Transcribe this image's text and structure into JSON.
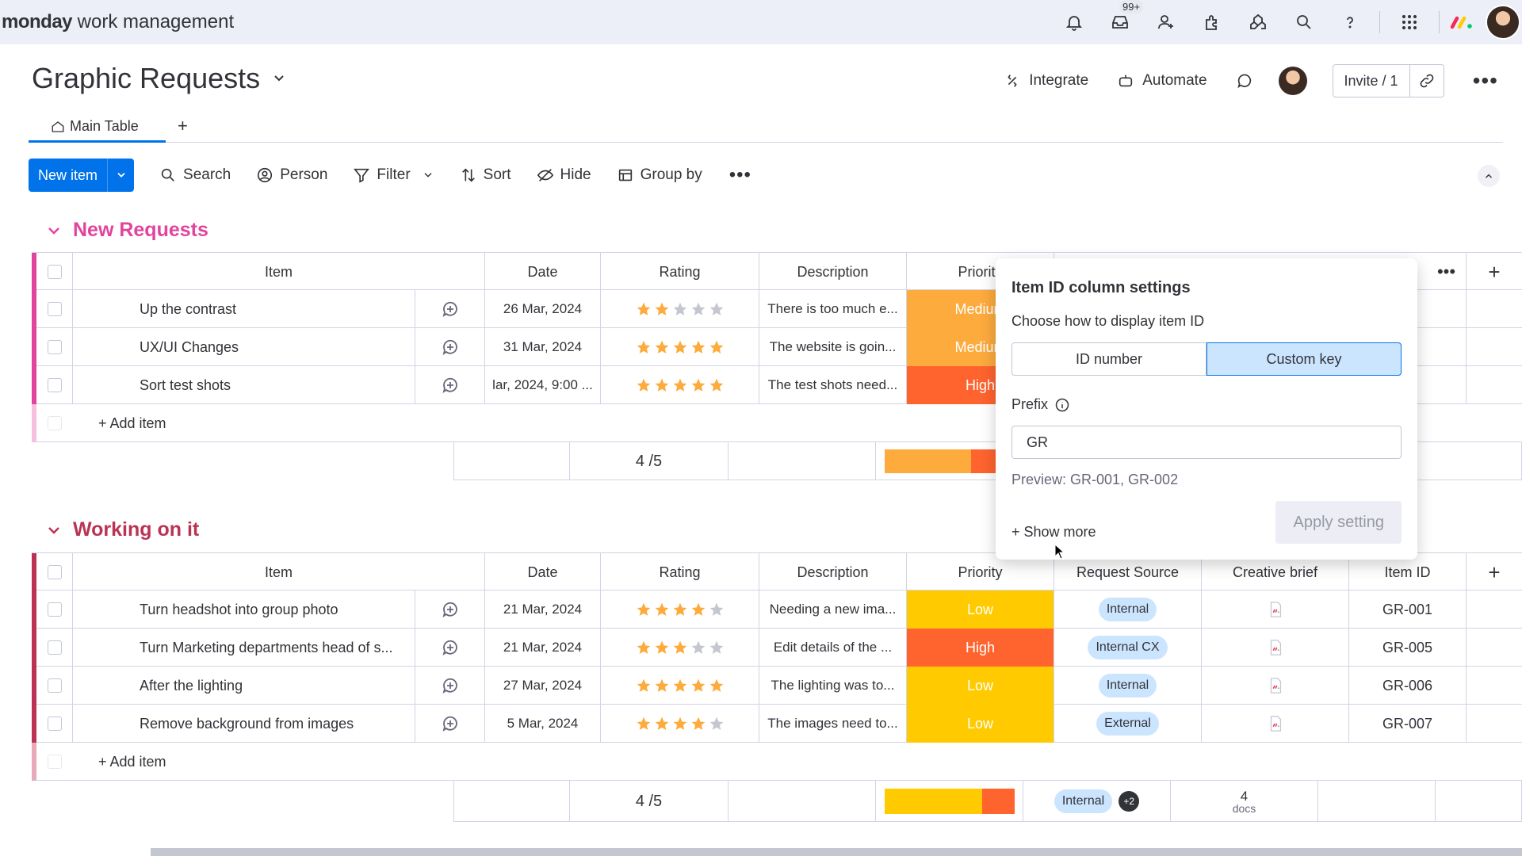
{
  "app": {
    "brand_bold": "monday",
    "brand_rest": " work management",
    "notif_badge": "99+"
  },
  "board": {
    "title": "Graphic Requests",
    "integrate": "Integrate",
    "automate": "Automate",
    "invite": "Invite / 1",
    "tab_main": "Main Table",
    "tab_add": "+"
  },
  "toolbar": {
    "new_item": "New item",
    "search": "Search",
    "person": "Person",
    "filter": "Filter",
    "sort": "Sort",
    "hide": "Hide",
    "group_by": "Group by"
  },
  "columns": {
    "item": "Item",
    "date": "Date",
    "rating": "Rating",
    "description": "Description",
    "priority": "Priority",
    "request_source": "Request Source",
    "creative_brief": "Creative brief",
    "item_id": "Item ID"
  },
  "colors": {
    "accent": "#0073ea",
    "medium": "#fdab3d",
    "high": "#e2445c",
    "high_orange": "#ff642e",
    "low": "#ffcb00",
    "group1": "#e2449d",
    "group2": "#bb3354",
    "star": "#fdab3d"
  },
  "groups": [
    {
      "title": "New Requests",
      "add_item": "+ Add item",
      "rating_summary": "4 /5",
      "items": [
        {
          "name": "Up the contrast",
          "date": "26 Mar, 2024",
          "rating": 2,
          "description": "There is too much e...",
          "priority": "Medium"
        },
        {
          "name": "UX/UI Changes",
          "date": "31 Mar, 2024",
          "rating": 5,
          "description": "The website is goin...",
          "priority": "Medium"
        },
        {
          "name": "Sort test shots",
          "date": "lar, 2024, 9:00 ...",
          "rating": 5,
          "description": "The test shots need...",
          "priority": "High"
        }
      ]
    },
    {
      "title": "Working on it",
      "add_item": "+ Add item",
      "rating_summary": "4 /5",
      "source_summary": "Internal",
      "source_more": "+2",
      "docs_count": "4",
      "docs_label": "docs",
      "items": [
        {
          "name": "Turn headshot into group photo",
          "date": "21 Mar, 2024",
          "rating": 4,
          "description": "Needing a new ima...",
          "priority": "Low",
          "source": "Internal",
          "item_id": "GR-001"
        },
        {
          "name": "Turn Marketing departments head of s...",
          "date": "21 Mar, 2024",
          "rating": 3,
          "description": "Edit details of the ...",
          "priority": "High",
          "source": "Internal CX",
          "item_id": "GR-005"
        },
        {
          "name": "After the lighting",
          "date": "27 Mar, 2024",
          "rating": 5,
          "description": "The lighting was to...",
          "priority": "Low",
          "source": "Internal",
          "item_id": "GR-006"
        },
        {
          "name": "Remove background from images",
          "date": "5 Mar, 2024",
          "rating": 4,
          "description": "The images need to...",
          "priority": "Low",
          "source": "External",
          "item_id": "GR-007"
        }
      ]
    }
  ],
  "popover": {
    "title": "Item ID column settings",
    "subtitle": "Choose how to display item ID",
    "opt_id_number": "ID number",
    "opt_custom_key": "Custom key",
    "prefix_label": "Prefix",
    "prefix_value": "GR",
    "preview": "Preview: GR-001, GR-002",
    "show_more": "+ Show more",
    "apply": "Apply setting"
  }
}
